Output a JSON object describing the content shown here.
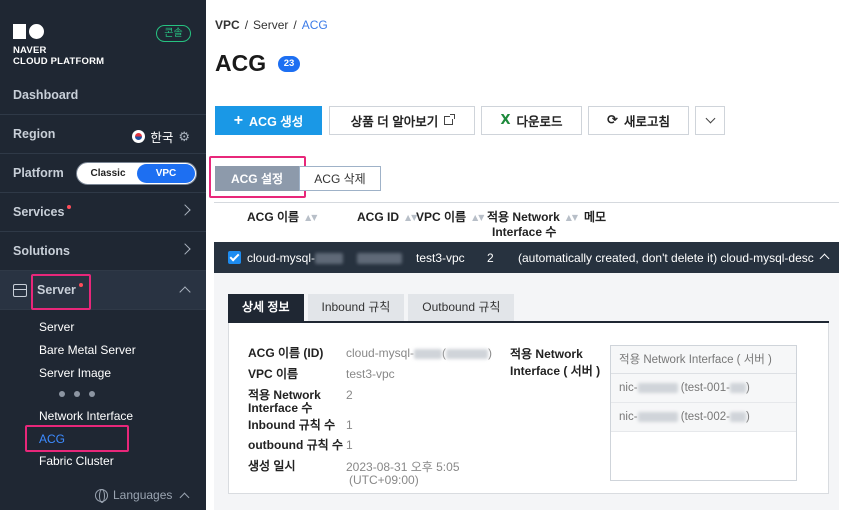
{
  "sidebar": {
    "logo_line1": "NAVER",
    "logo_line2": "CLOUD PLATFORM",
    "console_badge": "콘솔",
    "dashboard": "Dashboard",
    "region_label": "Region",
    "region_value": "한국",
    "platform_label": "Platform",
    "platform_classic": "Classic",
    "platform_vpc": "VPC",
    "services": "Services",
    "solutions": "Solutions",
    "server": "Server",
    "server_items": [
      "Server",
      "Bare Metal Server",
      "Server Image",
      "Network Interface",
      "ACG",
      "Fabric Cluster"
    ],
    "languages": "Languages"
  },
  "breadcrumb": {
    "vpc": "VPC",
    "server": "Server",
    "current": "ACG"
  },
  "page": {
    "title": "ACG",
    "count": "23"
  },
  "toolbar": {
    "create": "ACG 생성",
    "learn_more": "상품 더 알아보기",
    "download": "다운로드",
    "refresh": "새로고침"
  },
  "actions": {
    "setting": "ACG 설정",
    "delete": "ACG 삭제"
  },
  "table": {
    "headers": {
      "name": "ACG 이름",
      "id": "ACG ID",
      "vpc": "VPC 이름",
      "ni_line1": "적용 Network",
      "ni_line2": "Interface 수",
      "memo": "메모"
    },
    "row": {
      "name": "cloud-mysql-",
      "vpc": "test3-vpc",
      "ni_count": "2",
      "memo": "(automatically created, don't delete it) cloud-mysql-desc"
    }
  },
  "detail": {
    "tabs": [
      "상세 정보",
      "Inbound 규칙",
      "Outbound 규칙"
    ],
    "fields": {
      "acg_name_label": "ACG 이름 (ID)",
      "acg_name_value": "cloud-mysql-",
      "acg_name_paren_open": "(",
      "acg_name_paren_close": ")",
      "vpc_label": "VPC 이름",
      "vpc_value": "test3-vpc",
      "ni_label_1": "적용 Network",
      "ni_label_2": "Interface 수",
      "ni_value": "2",
      "inbound_label": "Inbound 규칙 수",
      "inbound_value": "1",
      "outbound_label": "outbound 규칙 수",
      "outbound_value": "1",
      "created_label": "생성 일시",
      "created_value_1": "2023-08-31 오후 5:05",
      "created_value_2": "(UTC+09:00)"
    },
    "applied_ni": {
      "label_1": "적용 Network",
      "label_2": "Interface ( 서버 )",
      "header": "적용 Network Interface ( 서버 )",
      "rows": [
        {
          "prefix": "nic-",
          "server": "(test-001-",
          "close": ")"
        },
        {
          "prefix": "nic-",
          "server": "(test-002-",
          "close": ")"
        }
      ]
    }
  },
  "colors": {
    "sidebar_bg": "#1f2733",
    "accent_blue": "#1d6ff2",
    "primary_button": "#1a98e6",
    "highlight": "#e8277a",
    "console_green": "#26c281"
  }
}
